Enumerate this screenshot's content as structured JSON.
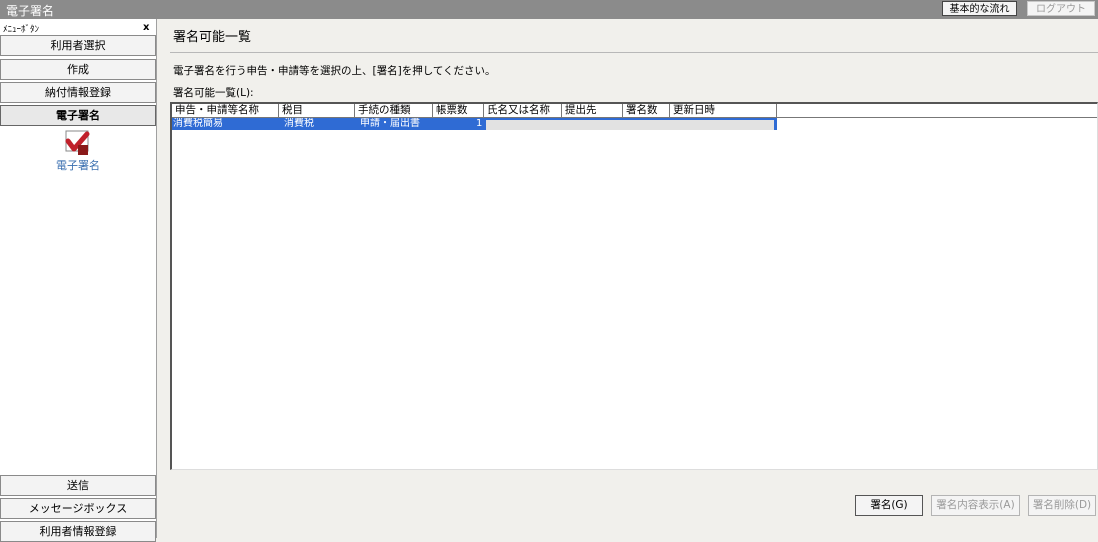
{
  "window": {
    "title": "電子署名",
    "flow_button": "基本的な流れ",
    "logout_button": "ログアウト"
  },
  "sidebar": {
    "header": "ﾒﾆｭｰﾎﾞﾀﾝ",
    "close_glyph": "x",
    "top_items": [
      {
        "label": "利用者選択"
      },
      {
        "label": "作成"
      },
      {
        "label": "納付情報登録"
      },
      {
        "label": "電子署名"
      }
    ],
    "sub_item_label": "電子署名",
    "bottom_items": [
      {
        "label": "送信"
      },
      {
        "label": "メッセージボックス"
      },
      {
        "label": "利用者情報登録"
      }
    ]
  },
  "main": {
    "title": "署名可能一覧",
    "instruction": "電子署名を行う申告・申請等を選択の上、[署名]を押してください。",
    "list_caption": "署名可能一覧(L):",
    "columns": [
      "申告・申請等名称",
      "税目",
      "手続の種類",
      "帳票数",
      "氏名又は名称",
      "提出先",
      "署名数",
      "更新日時"
    ],
    "rows": [
      {
        "name": "消費税簡易",
        "tax": "消費税",
        "procedure": "申請・届出書",
        "forms": "1"
      }
    ]
  },
  "actions": {
    "sign": "署名(G)",
    "show_signature": "署名内容表示(A)",
    "delete_signature": "署名削除(D)"
  },
  "colors": {
    "titlebar": "#8b8b8b",
    "selection": "#2f6bd4",
    "sub_label": "#3a6fb0"
  }
}
